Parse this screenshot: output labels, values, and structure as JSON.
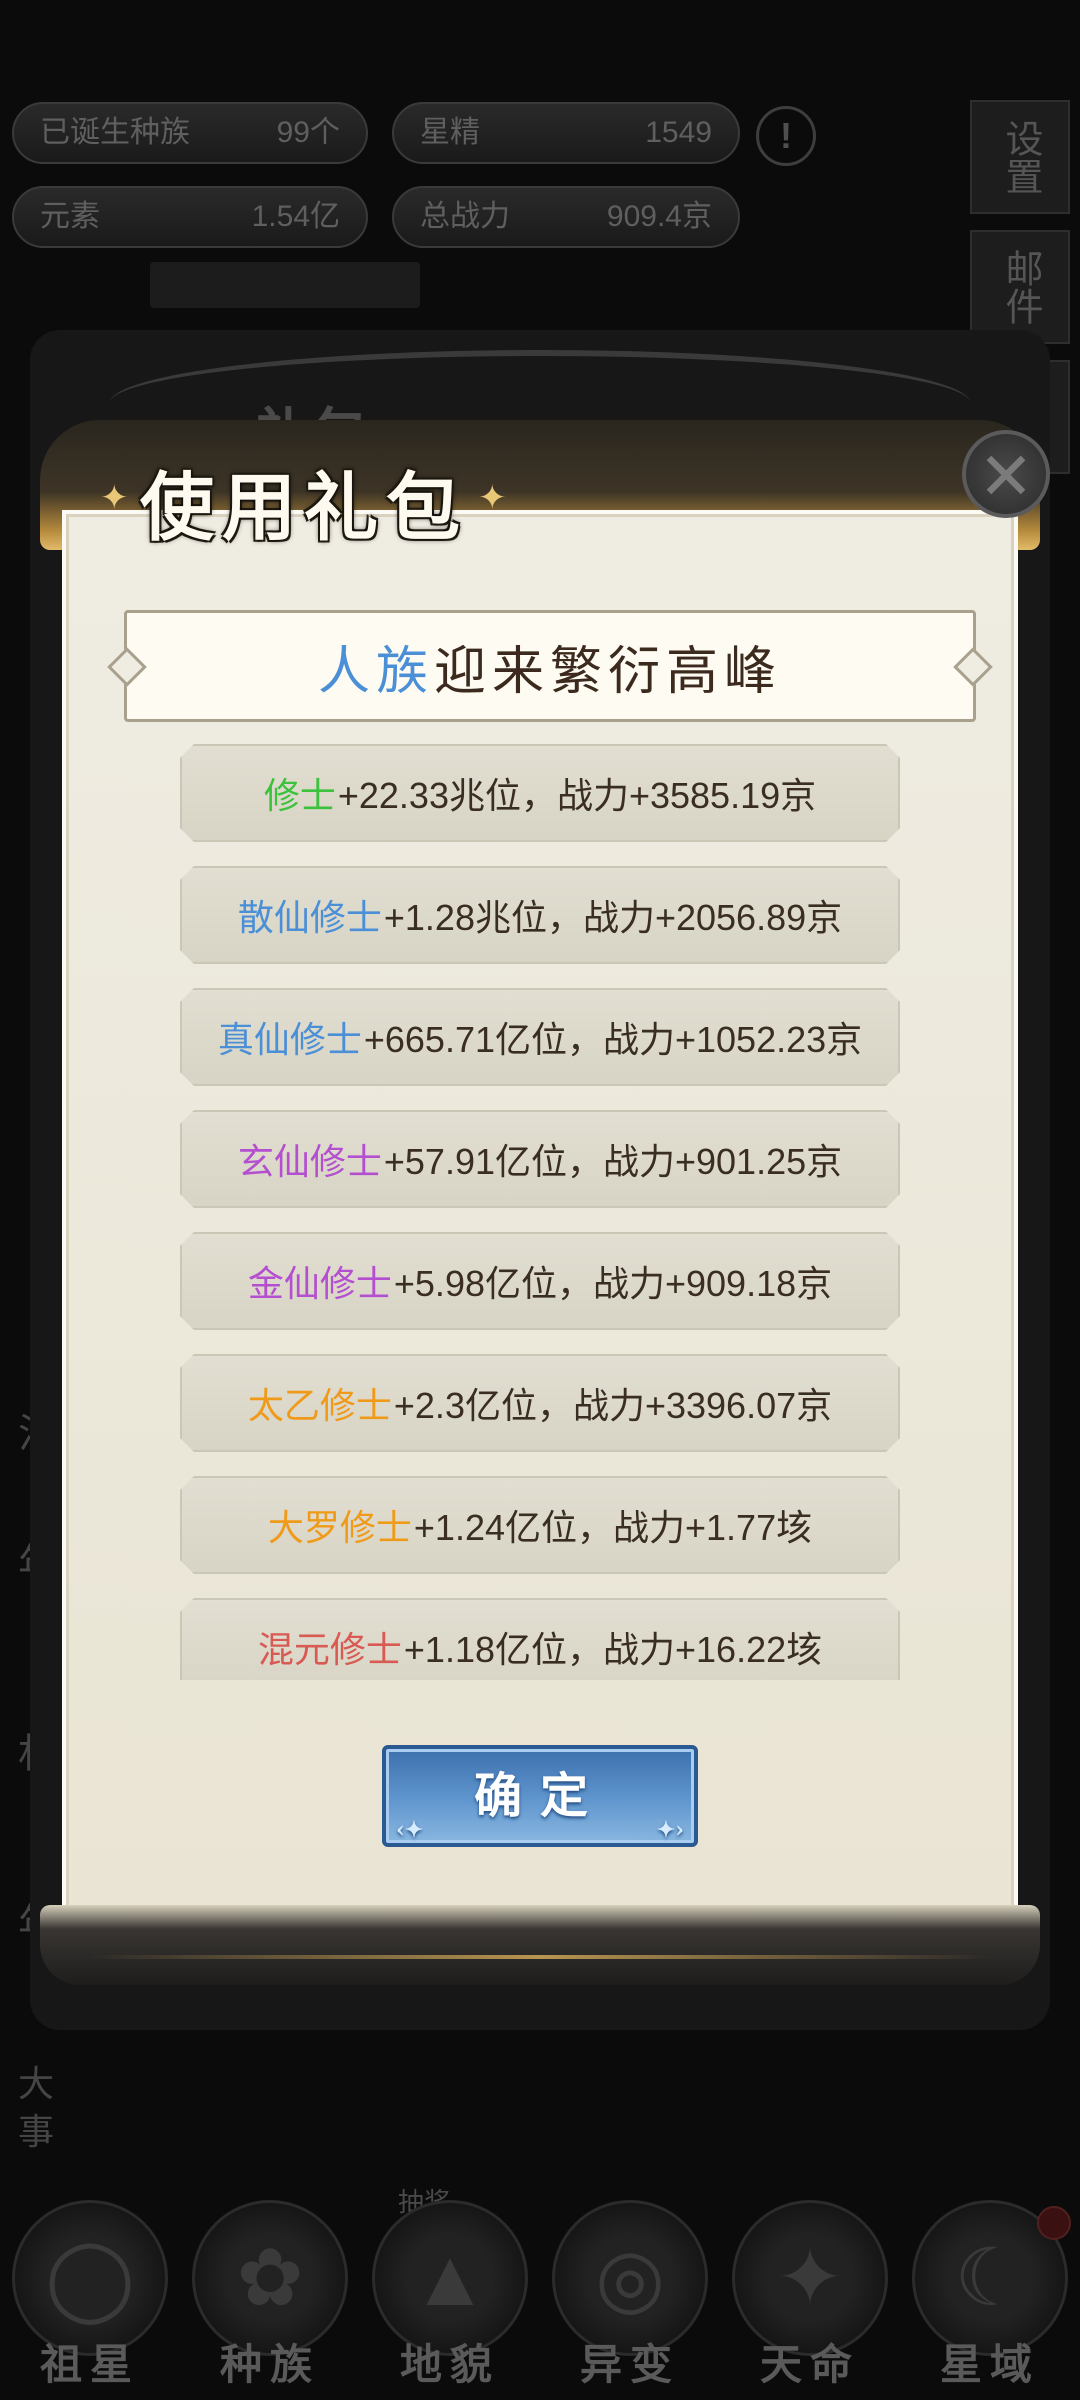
{
  "background": {
    "stats": [
      {
        "label": "已诞生种族",
        "value": "99个"
      },
      {
        "label": "星精",
        "value": "1549"
      },
      {
        "label": "元素",
        "value": "1.54亿"
      },
      {
        "label": "总战力",
        "value": "909.4京"
      }
    ],
    "side_buttons": [
      "设置",
      "邮件",
      "排"
    ],
    "left_labels": [
      "法",
      "年",
      "村",
      "年"
    ],
    "events_label": "大事",
    "bottom_nav": [
      {
        "label": "祖星",
        "icon": "planet-icon"
      },
      {
        "label": "种族",
        "icon": "race-icon"
      },
      {
        "label": "地貌",
        "icon": "mountain-icon"
      },
      {
        "label": "异变",
        "icon": "swirl-icon"
      },
      {
        "label": "天命",
        "icon": "fate-icon"
      },
      {
        "label": "星域",
        "icon": "star-region-icon"
      }
    ],
    "ghost_title": "礼包",
    "bottom_hint": "抽奖"
  },
  "dialog": {
    "title": "使用礼包",
    "headline": {
      "race": "人族",
      "text": "迎来繁衍高峰"
    },
    "rewards": [
      {
        "rank": "修士",
        "color": "#3cc23c",
        "detail": "+22.33兆位，战力+3585.19京"
      },
      {
        "rank": "散仙修士",
        "color": "#4b8fd6",
        "detail": "+1.28兆位，战力+2056.89京"
      },
      {
        "rank": "真仙修士",
        "color": "#4b8fd6",
        "detail": "+665.71亿位，战力+1052.23京"
      },
      {
        "rank": "玄仙修士",
        "color": "#b44fd0",
        "detail": "+57.91亿位，战力+901.25京"
      },
      {
        "rank": "金仙修士",
        "color": "#b44fd0",
        "detail": "+5.98亿位，战力+909.18京"
      },
      {
        "rank": "太乙修士",
        "color": "#f09a1a",
        "detail": "+2.3亿位，战力+3396.07京"
      },
      {
        "rank": "大罗修士",
        "color": "#f09a1a",
        "detail": "+1.24亿位，战力+1.77垓"
      },
      {
        "rank": "混元修士",
        "color": "#d85a52",
        "detail": "+1.18亿位，战力+16.22垓"
      }
    ],
    "confirm_label": "确定"
  }
}
